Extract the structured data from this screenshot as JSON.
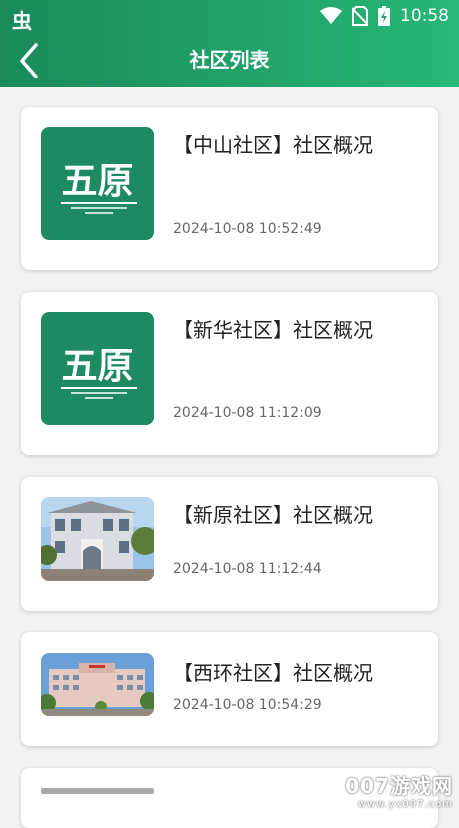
{
  "status": {
    "app_icon": "虫",
    "time": "10:58"
  },
  "header": {
    "title": "社区列表"
  },
  "colors": {
    "header_start": "#1a8a5a",
    "header_end": "#27b879",
    "logo_bg": "#1e8a62"
  },
  "logo_text": "五原",
  "cards": [
    {
      "title": "【中山社区】社区概况",
      "time": "2024-10-08 10:52:49",
      "thumb": "logo"
    },
    {
      "title": "【新华社区】社区概况",
      "time": "2024-10-08 11:12:09",
      "thumb": "logo"
    },
    {
      "title": "【新原社区】社区概况",
      "time": "2024-10-08 11:12:44",
      "thumb": "photo-building-1"
    },
    {
      "title": "【西环社区】社区概况",
      "time": "2024-10-08 10:54:29",
      "thumb": "photo-building-2"
    }
  ],
  "watermark": {
    "main": "007游戏网",
    "url": "www.yx007.com"
  }
}
